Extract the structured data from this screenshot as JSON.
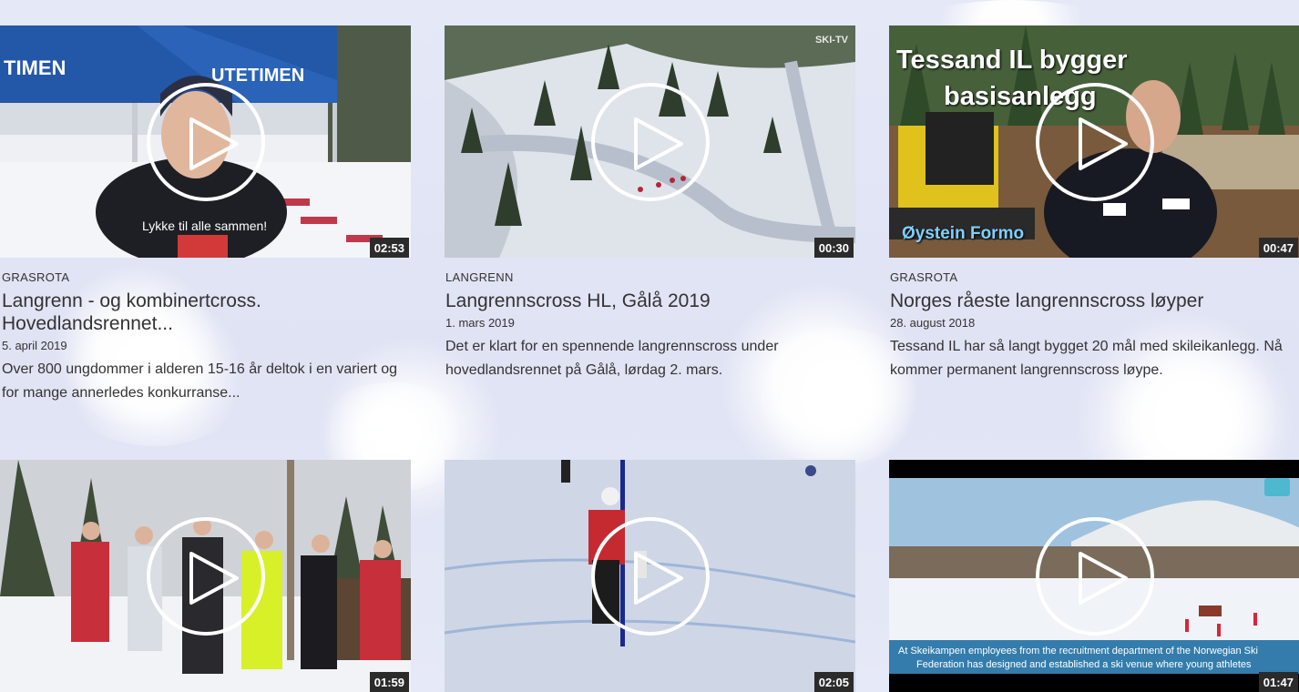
{
  "videos": [
    {
      "category": "GRASROTA",
      "title": "Langrenn - og kombinertcross. Hovedlandsrennet...",
      "date": "5. april 2019",
      "description": "Over 800 ungdommer i alderen 15-16 år deltok i en variert og for mange annerledes konkurranse...",
      "duration": "02:53",
      "caption": "Lykke til alle sammen!",
      "tent_text_1": "TIMEN",
      "tent_text_2": "UTETIMEN"
    },
    {
      "category": "LANGRENN",
      "title": "Langrennscross HL, Gålå 2019",
      "date": "1. mars 2019",
      "description": "Det er klart for en spennende langrennscross under hovedlandsrennet på Gålå, lørdag 2. mars.",
      "duration": "00:30",
      "watermark": "SKI-TV"
    },
    {
      "category": "GRASROTA",
      "title": "Norges råeste langrennscross løyper",
      "date": "28. august 2018",
      "description": "Tessand IL har så langt bygget 20 mål med skileikanlegg. Nå kommer permanent langrennscross løype.",
      "duration": "00:47",
      "headline_1": "Tessand IL bygger",
      "headline_2": "basisanlegg",
      "name_tag": "Øystein Formo"
    },
    {
      "duration": "01:59"
    },
    {
      "duration": "02:05"
    },
    {
      "duration": "01:47",
      "subtitle_1": "At Skeikampen employees from the recruitment department of the Norwegian Ski",
      "subtitle_2": "Federation has designed and established a ski venue where young athletes"
    }
  ],
  "icons": {
    "play": "play-icon"
  },
  "colors": {
    "duration_bg": "#2b2b2b",
    "text": "#333333",
    "background": "#e4e8f7"
  }
}
